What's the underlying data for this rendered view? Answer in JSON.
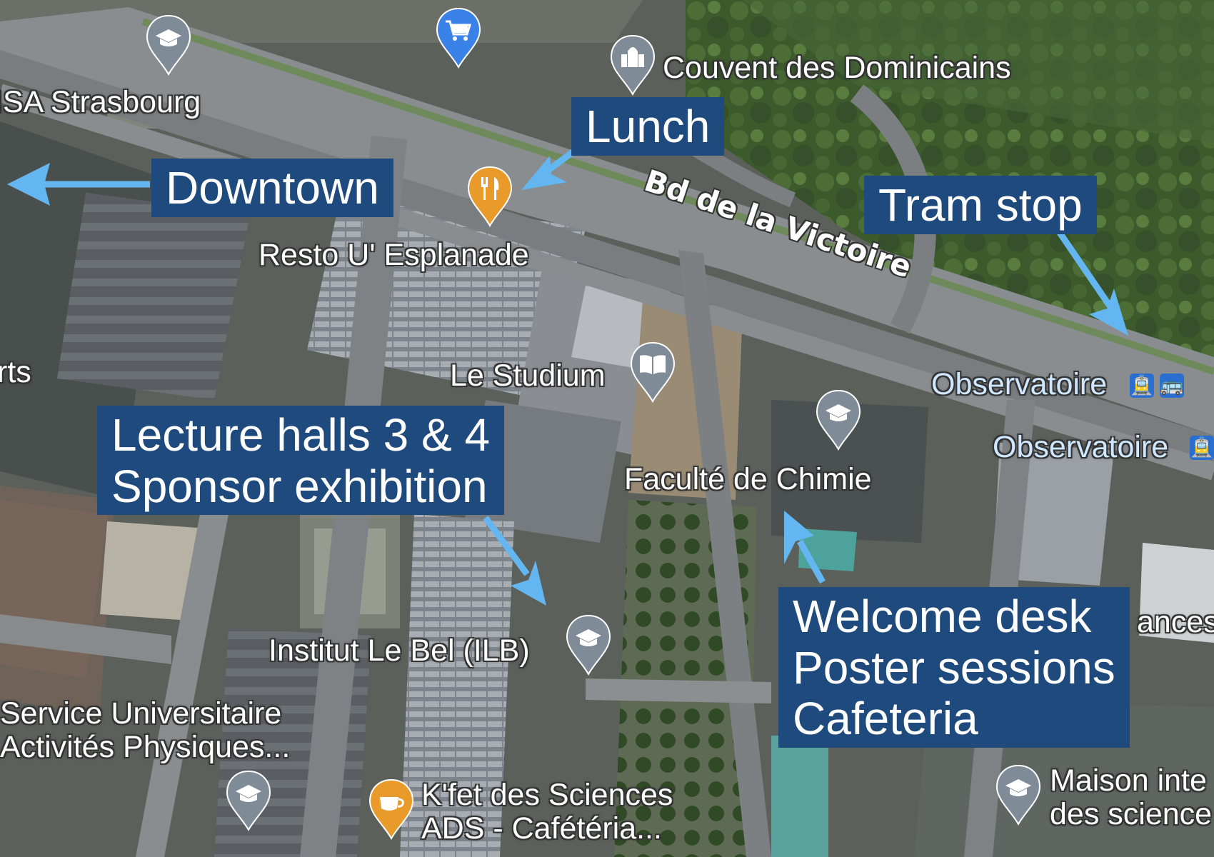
{
  "map": {
    "road": "Bd de la Victoire",
    "places": {
      "insa": "ISA Strasbourg",
      "arts": "rts",
      "couvent": "Couvent des Dominicains",
      "resto": "Resto U' Esplanade",
      "studium": "Le Studium",
      "chimie": "Faculté de Chimie",
      "observatoire1": "Observatoire",
      "observatoire2": "Observatoire",
      "ilb": "Institut Le Bel (ILB)",
      "suaps_line1": "Service Universitaire",
      "suaps_line2": "Activités Physiques...",
      "kfet_line1": "K'fet des Sciences",
      "kfet_line2": "ADS - Cafétéria...",
      "maison_line1": "Maison inte",
      "maison_line2": "des science",
      "ances": "ances"
    }
  },
  "annotations": {
    "lunch": "Lunch",
    "downtown": "Downtown",
    "tram": "Tram stop",
    "halls_line1": "Lecture halls 3 & 4",
    "halls_line2": "Sponsor exhibition",
    "welcome_line1": "Welcome desk",
    "welcome_line2": "Poster sessions",
    "welcome_line3": "Cafeteria"
  },
  "icons": {
    "university": "graduation-cap-icon",
    "shopping": "shopping-cart-icon",
    "restaurant": "fork-knife-icon",
    "library": "open-book-icon",
    "church": "church-icon",
    "cafe": "coffee-cup-icon",
    "tram": "tram-icon",
    "bus": "bus-icon"
  },
  "colors": {
    "annotation_box": "#1f4a7e",
    "arrow": "#63b6f0",
    "pin_gray": "#7f8c98",
    "pin_blue": "#3b82e8",
    "pin_orange": "#e89a2a"
  }
}
